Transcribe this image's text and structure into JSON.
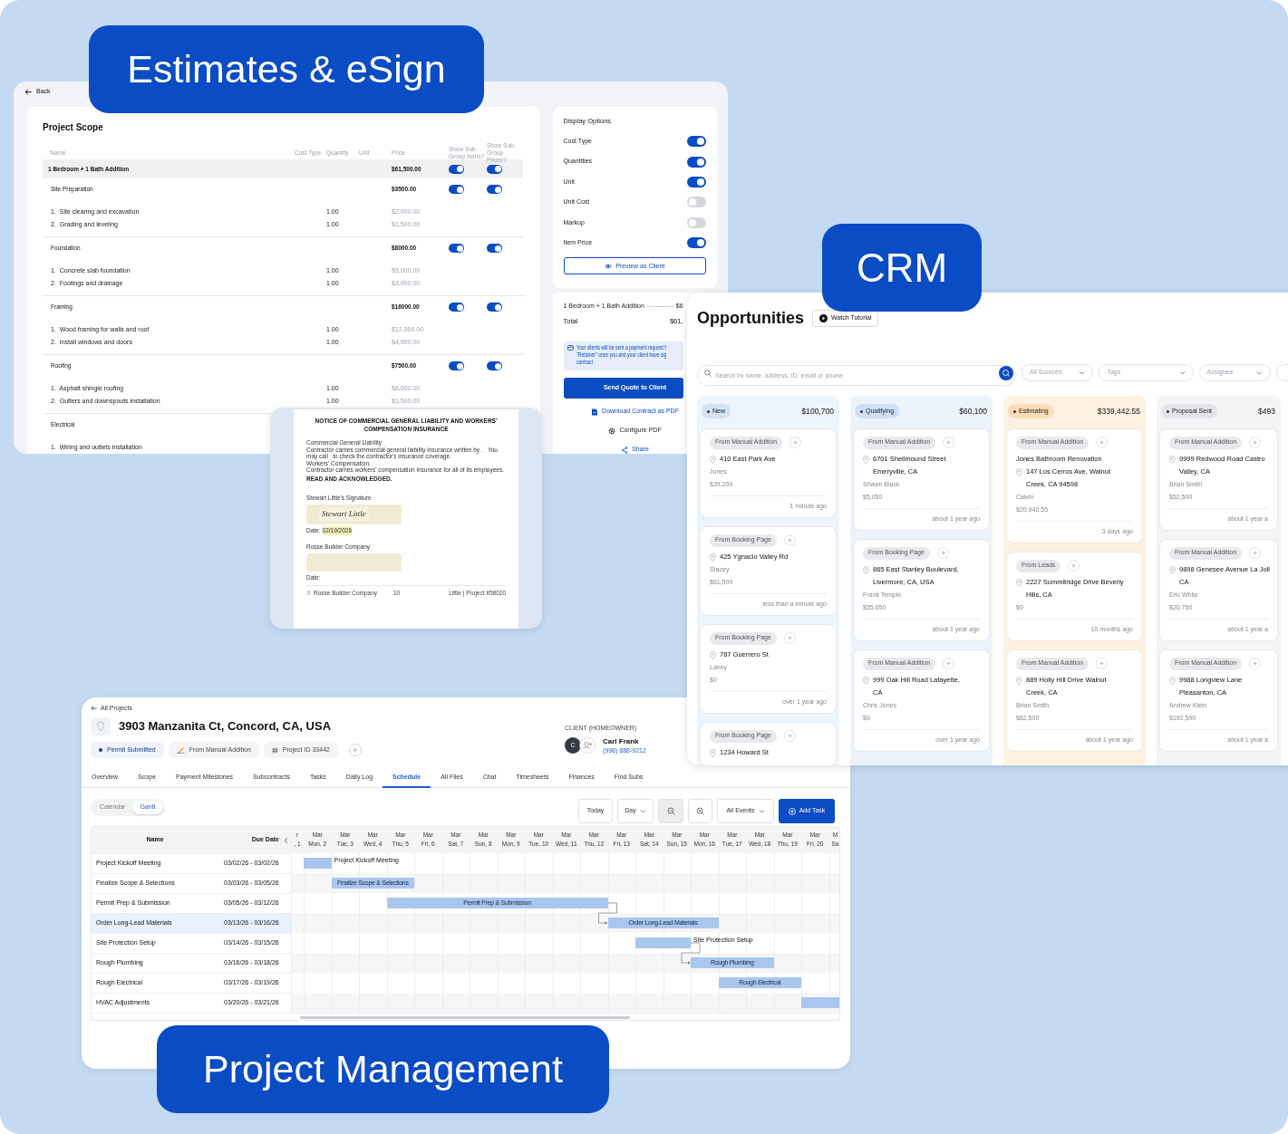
{
  "estimates": {
    "badge": "Estimates & eSign",
    "back": "Back",
    "title": "Project Scope",
    "columns": [
      "Name",
      "Cost Type",
      "Quantity",
      "Unit",
      "Price",
      "Show Sub-Group Items?",
      "Show Sub-Group Prices?"
    ],
    "group": {
      "name": "1 Bedroom + 1 Bath Addition",
      "price": "$61,500.00",
      "show_items": true,
      "show_prices": true
    },
    "sections": [
      {
        "name": "Site Preparation",
        "price": "$3500.00",
        "show_items": true,
        "show_prices": true,
        "items": [
          {
            "name": "1.  Site clearing and excavation",
            "quantity": "1.00",
            "price": "$2,000.00"
          },
          {
            "name": "2.  Grading and leveling",
            "quantity": "1.00",
            "price": "$1,500.00"
          }
        ]
      },
      {
        "name": "Foundation",
        "price": "$8000.00",
        "show_items": true,
        "show_prices": true,
        "items": [
          {
            "name": "1.  Concrete slab foundation",
            "quantity": "1.00",
            "price": "$5,000.00"
          },
          {
            "name": "2.  Footings and drainage",
            "quantity": "1.00",
            "price": "$3,000.00"
          }
        ]
      },
      {
        "name": "Framing",
        "price": "$16000.00",
        "show_items": true,
        "show_prices": true,
        "items": [
          {
            "name": "1.  Wood framing for walls and roof",
            "quantity": "1.00",
            "price": "$12,000.00"
          },
          {
            "name": "2.  Install windows and doors",
            "quantity": "1.00",
            "price": "$4,000.00"
          }
        ]
      },
      {
        "name": "Roofing",
        "price": "$7500.00",
        "show_items": true,
        "show_prices": true,
        "items": [
          {
            "name": "1.  Asphalt shingle roofing",
            "quantity": "1.00",
            "price": "$6,000.00"
          },
          {
            "name": "2.  Gutters and downspouts installation",
            "quantity": "1.00",
            "price": "$1,500.00"
          }
        ]
      },
      {
        "name": "Electrical",
        "items": [
          {
            "name": "1.  Wiring and outlets installation"
          }
        ]
      }
    ],
    "display_options": {
      "title": "Display Options",
      "options": [
        {
          "label": "Cost Type",
          "on": true
        },
        {
          "label": "Quantities",
          "on": true
        },
        {
          "label": "Unit",
          "on": true
        },
        {
          "label": "Unit Cost",
          "on": false
        },
        {
          "label": "Markup",
          "on": false
        },
        {
          "label": "Item Price",
          "on": true
        }
      ],
      "preview_button": "Preview as Client"
    },
    "summary": {
      "line_label": "1 Bedroom + 1 Bath Addition",
      "line_value": "$6",
      "total_label": "Total",
      "total_value": "$61,",
      "notice_lines": [
        "Your clients will be sent a payment request f",
        "\"Retainer\" once you and your client have sig",
        "contract"
      ],
      "send_button": "Send Quote to Client",
      "links": [
        {
          "kind": "download",
          "label": "Download Contract as PDF"
        },
        {
          "kind": "configure",
          "label": "Configure PDF"
        },
        {
          "kind": "share",
          "label": "Share"
        }
      ]
    }
  },
  "document": {
    "title": "NOTICE OF COMMERCIAL GENERAL LIABILITY AND WORKERS' COMPENSATION INSURANCE",
    "body": [
      "Commercial General Liability",
      "Contractor carries commercial general liability insurance written by .   You may call   to check the contractor's insurance coverage.",
      "Workers' Compensation:",
      "Contractor carries workers' compensation insurance for all of its employees."
    ],
    "acknowledgement": "READ AND ACKNOWLEDGED.",
    "signer_label": "Stewart Little's Signature",
    "signature": "Stewart Little",
    "date_label": "Date:",
    "date": "02/19/2026",
    "company_label": "Rosse Builder Company",
    "company_date_label": "Date:",
    "footer": {
      "company": "Rosse Builder Company",
      "page": "10",
      "project": "Little | Project #58020"
    }
  },
  "crm": {
    "badge": "CRM",
    "title": "Opportunities",
    "tutorial_button": "Watch Tutorial",
    "search": {
      "placeholder": "Search by name, address, ID, email or phone"
    },
    "filters": [
      "All Sources",
      "Tags",
      "Assignee"
    ],
    "columns": [
      {
        "stage": "New",
        "color": "#d3e3f6",
        "total": "$100,700",
        "cards": [
          {
            "source": "From Manual Addition",
            "address": [
              "410 East Park Ave"
            ],
            "name": "Jones",
            "amount": "$39,200",
            "time": "1 minute ago"
          },
          {
            "source": "From Booking Page",
            "address": [
              "425 Ygnacio Valley Rd"
            ],
            "name": "Stacey",
            "amount": "$61,500",
            "time": "less than a minute ago"
          },
          {
            "source": "From Booking Page",
            "address": [
              "787 Guerrero St"
            ],
            "name": "Laney",
            "amount": "$0",
            "time": "over 1 year ago"
          },
          {
            "source": "From Booking Page",
            "address": [
              "1234 Howard St"
            ]
          }
        ]
      },
      {
        "stage": "Qualifying",
        "color": "#cfe0f6",
        "total": "$60,100",
        "cards": [
          {
            "source": "From Manual Addition",
            "address": [
              "6701 Shellmound Street",
              "Emeryville, CA"
            ],
            "name": "Shawn Black",
            "amount": "$5,050",
            "time": "about 1 year ago"
          },
          {
            "source": "From Booking Page",
            "address": [
              "865 East Stanley Boulevard,",
              "Livermore, CA, USA"
            ],
            "name": "Frank Temple",
            "amount": "$55,050",
            "time": "about 1 year ago"
          },
          {
            "source": "From Manual Addition",
            "address": [
              "999 Oak Hill Road Lafayette,",
              "CA"
            ],
            "name": "Chris Jones",
            "amount": "$0",
            "time": "over 1 year ago"
          }
        ]
      },
      {
        "stage": "Estimating",
        "color": "#fbdcb4",
        "total": "$339,442.55",
        "cards": [
          {
            "source": "From Manual Addition",
            "title": "Jones Bathroom Renovation",
            "address": [
              "147 Los Cerros Ave, Walnut",
              "Creek, CA 94598"
            ],
            "name": "Calvin",
            "amount": "$20,942.55",
            "time": "3 days ago"
          },
          {
            "source": "From Leads",
            "address": [
              "2227 Summitridge Drive Beverly",
              "Hills, CA"
            ],
            "amount": "$0",
            "time": "10 months ago"
          },
          {
            "source": "From Manual Addition",
            "address": [
              "889 Holly Hill Drive Walnut",
              "Creek, CA"
            ],
            "name": "Brian Smith",
            "amount": "$82,500",
            "time": "about 1 year ago"
          }
        ]
      },
      {
        "stage": "Proposal Sent",
        "color": "#e4e3ea",
        "total": "$493",
        "cards": [
          {
            "source": "From Manual Addition",
            "address": [
              "9999 Redwood Road Castro",
              "Valley, CA"
            ],
            "name": "Brian Smith",
            "amount": "$52,500",
            "time": "about 1 year a"
          },
          {
            "source": "From Manual Addition",
            "address": [
              "9898 Genesee Avenue La Joll",
              "CA"
            ],
            "name": "Eric White",
            "amount": "$20,750",
            "time": "about 1 year a"
          },
          {
            "source": "From Manual Addition",
            "address": [
              "9988 Longview Lane",
              "Pleasanton, CA"
            ],
            "name": "Andrew Klein",
            "amount": "$192,500",
            "time": "about 1 year a"
          }
        ]
      }
    ]
  },
  "pm": {
    "badge": "Project Management",
    "back": "All Projects",
    "title": "3903 Manzanita Ct, Concord, CA, USA",
    "chips": [
      {
        "kind": "status",
        "label": "Permit Submitted"
      },
      {
        "kind": "source",
        "label": "From Manual Addition"
      },
      {
        "kind": "id",
        "label": "Project ID 33442"
      }
    ],
    "client": {
      "heading": "CLIENT (HOMEOWNER)",
      "initial": "C",
      "name": "Carl Frank",
      "phone": "(998) 888-9212"
    },
    "tabs": [
      {
        "label": "Overview",
        "selected": false
      },
      {
        "label": "Scope",
        "selected": false
      },
      {
        "label": "Payment Milestones",
        "selected": false
      },
      {
        "label": "Subcontracts",
        "selected": false
      },
      {
        "label": "Tasks",
        "selected": false
      },
      {
        "label": "Daily Log",
        "selected": false
      },
      {
        "label": "Schedule",
        "selected": true
      },
      {
        "label": "All Files",
        "selected": false
      },
      {
        "label": "Chat",
        "selected": false
      },
      {
        "label": "Timesheets",
        "selected": false
      },
      {
        "label": "Finances",
        "selected": false
      },
      {
        "label": "Find Subs",
        "selected": false
      }
    ],
    "views": [
      {
        "label": "Calendar",
        "selected": false
      },
      {
        "label": "Gantt",
        "selected": true
      }
    ],
    "toolbar": {
      "today": "Today",
      "scale": "Day",
      "events": "All Events",
      "add_task": "Add Task"
    },
    "gantt": {
      "name_header": "Name",
      "date_header": "Due Date",
      "days": [
        {
          "kind": "clipped",
          "month": "r",
          "day": ", 1"
        },
        {
          "kind": "day",
          "month": "Mar",
          "day": "Mon, 2"
        },
        {
          "kind": "day",
          "month": "Mar",
          "day": "Tue, 3"
        },
        {
          "kind": "day",
          "month": "Mar",
          "day": "Wed, 4"
        },
        {
          "kind": "day",
          "month": "Mar",
          "day": "Thu, 5"
        },
        {
          "kind": "day",
          "month": "Mar",
          "day": "Fri, 6"
        },
        {
          "kind": "day",
          "month": "Mar",
          "day": "Sat, 7"
        },
        {
          "kind": "day",
          "month": "Mar",
          "day": "Sun, 8"
        },
        {
          "kind": "day",
          "month": "Mar",
          "day": "Mon, 9"
        },
        {
          "kind": "day",
          "month": "Mar",
          "day": "Tue, 10"
        },
        {
          "kind": "day",
          "month": "Mar",
          "day": "Wed, 11"
        },
        {
          "kind": "day",
          "month": "Mar",
          "day": "Thu, 12"
        },
        {
          "kind": "day",
          "month": "Mar",
          "day": "Fri, 13"
        },
        {
          "kind": "day",
          "month": "Mar",
          "day": "Sat, 14"
        },
        {
          "kind": "day",
          "month": "Mar",
          "day": "Sun, 15"
        },
        {
          "kind": "day",
          "month": "Mar",
          "day": "Mon, 16"
        },
        {
          "kind": "day",
          "month": "Mar",
          "day": "Tue, 17"
        },
        {
          "kind": "day",
          "month": "Mar",
          "day": "Wed, 18"
        },
        {
          "kind": "day",
          "month": "Mar",
          "day": "Thu, 19"
        },
        {
          "kind": "day",
          "month": "Mar",
          "day": "Fri, 20"
        },
        {
          "kind": "clipped",
          "month": "M",
          "day": "Sa"
        }
      ],
      "tasks": [
        {
          "name": "Project Kickoff Meeting",
          "dates": "03/02/26 - 03/02/26",
          "selected": false,
          "kind": "outside",
          "bar_label": "Project Kickoff Meeting",
          "arrow_from_previous": false
        },
        {
          "name": "Finalize Scope & Selections",
          "dates": "03/03/26 - 03/05/26",
          "selected": false,
          "kind": "inside",
          "bar_label": "Finalize Scope & Selections",
          "arrow_from_previous": false
        },
        {
          "name": "Permit Prep & Submission",
          "dates": "03/05/26 - 03/12/26",
          "selected": false,
          "kind": "inside",
          "bar_label": "Permit Prep & Submission",
          "arrow_from_previous": false
        },
        {
          "name": "Order Long-Lead Materials",
          "dates": "03/13/26 - 03/16/26",
          "selected": true,
          "kind": "inside",
          "bar_label": "Order Long-Lead Materials",
          "arrow_from_previous": true
        },
        {
          "name": "Site Protection Setup",
          "dates": "03/14/26 - 03/15/26",
          "selected": false,
          "kind": "outside",
          "bar_label": "Site Protection Setup",
          "arrow_from_previous": false
        },
        {
          "name": "Rough Plumbing",
          "dates": "03/16/26 - 03/18/26",
          "selected": false,
          "kind": "inside",
          "bar_label": "Rough Plumbing",
          "arrow_from_previous": true
        },
        {
          "name": "Rough Electrical",
          "dates": "03/17/26 - 03/19/26",
          "selected": false,
          "kind": "inside",
          "bar_label": "Rough Electrical",
          "arrow_from_previous": false
        },
        {
          "name": "HVAC Adjustments",
          "dates": "03/20/26 - 03/21/26",
          "selected": false,
          "kind": "inside",
          "arrow_from_previous": false
        }
      ]
    }
  }
}
